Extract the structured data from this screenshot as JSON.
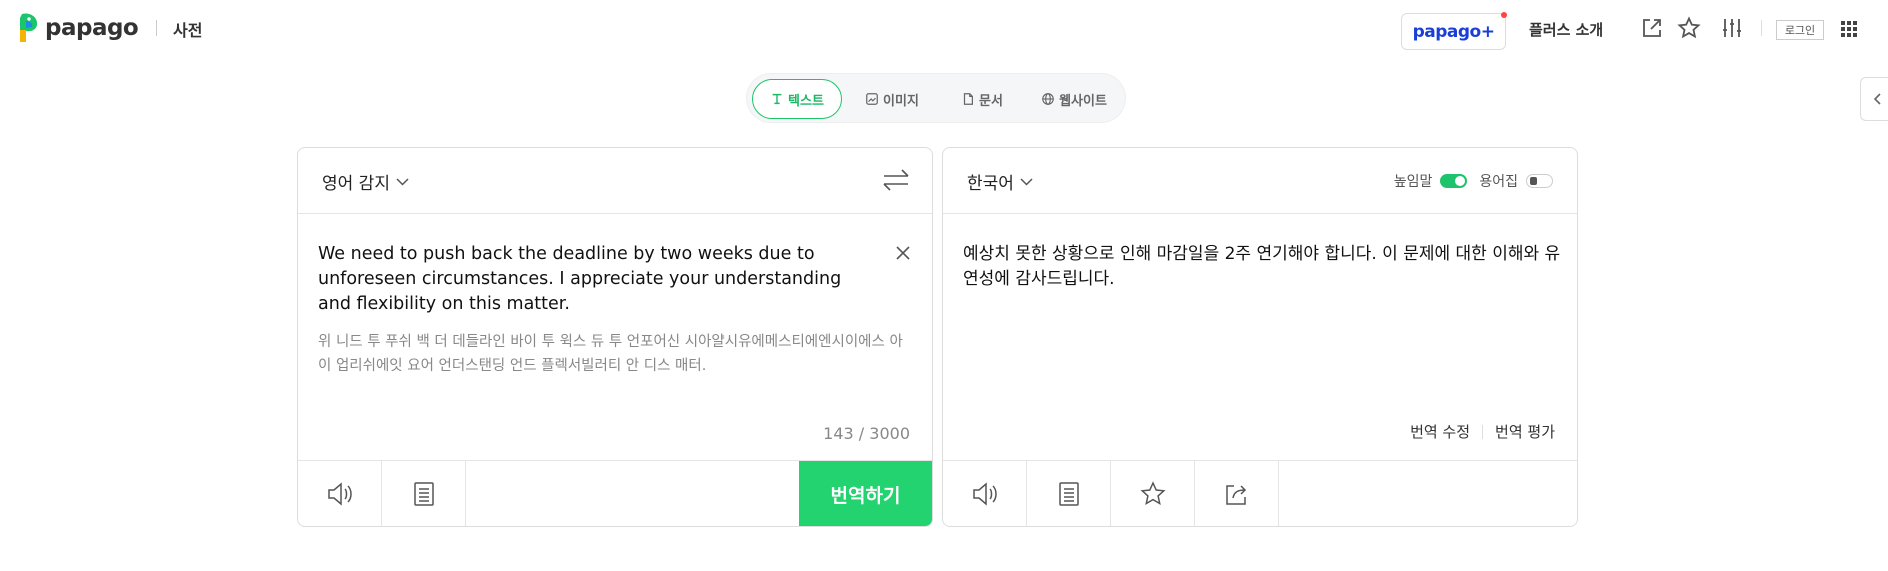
{
  "header": {
    "logo_text": "papago",
    "dict_label": "사전",
    "plus_label": "papago+",
    "plus_intro": "플러스 소개",
    "login_label": "로그인"
  },
  "icons": {
    "header": [
      "external-link-icon",
      "star-icon",
      "settings-sliders-icon",
      "apps-grid-icon"
    ],
    "source_footer": [
      "speaker-icon",
      "memo-icon"
    ],
    "target_footer": [
      "speaker-icon",
      "memo-icon",
      "star-icon",
      "share-icon"
    ]
  },
  "mode_tabs": [
    {
      "label": "텍스트",
      "icon": "text-icon",
      "active": true
    },
    {
      "label": "이미지",
      "icon": "image-icon",
      "active": false
    },
    {
      "label": "문서",
      "icon": "document-icon",
      "active": false
    },
    {
      "label": "웹사이트",
      "icon": "globe-icon",
      "active": false
    }
  ],
  "source": {
    "language": "영어 감지",
    "text": "We need to push back the deadline by two weeks due to unforeseen circumstances. I appreciate your understanding and flexibility on this matter.",
    "pronunciation": "위 니드 투 푸쉬 백 더 데들라인 바이 투 윅스 듀 투 언포어신 시아얄시유에메스티에엔시이에스 아이 업리쉬에잇 요어 언더스탠딩 언드 플렉서빌러티 안 디스 매터.",
    "char_count": "143 / 3000",
    "translate_label": "번역하기"
  },
  "target": {
    "language": "한국어",
    "honorific_label": "높임말",
    "honorific_on": true,
    "glossary_label": "용어집",
    "glossary_on": false,
    "text": "예상치 못한 상황으로 인해 마감일을 2주 연기해야 합니다. 이 문제에 대한 이해와 유연성에 감사드립니다.",
    "edit_label": "번역 수정",
    "rate_label": "번역 평가"
  },
  "colors": {
    "accent_green": "#1ec46b",
    "button_green": "#22d36f",
    "plus_blue": "#1a3fd6"
  }
}
